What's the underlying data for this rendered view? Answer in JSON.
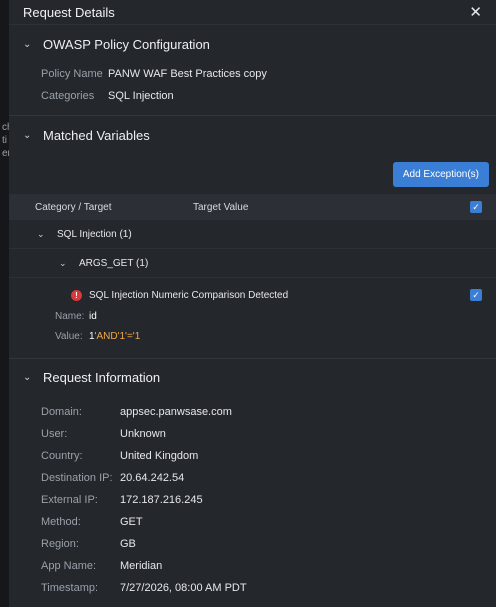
{
  "dialog": {
    "title": "Request Details"
  },
  "policy_section": {
    "title": "OWASP Policy Configuration",
    "policy_name_label": "Policy Name",
    "policy_name": "PANW WAF Best Practices copy",
    "categories_label": "Categories",
    "categories": "SQL Injection"
  },
  "matched_section": {
    "title": "Matched Variables",
    "add_exception_label": "Add Exception(s)",
    "columns": [
      "Category / Target",
      "Target Value"
    ],
    "group_label": "SQL Injection (1)",
    "subgroup_label": "ARGS_GET (1)",
    "detection": "SQL Injection Numeric Comparison Detected",
    "name_label": "Name:",
    "name_value": "id",
    "value_label": "Value:",
    "value_prefix": "1",
    "value_highlight": "'AND'1'='1"
  },
  "request_section": {
    "title": "Request Information",
    "fields": [
      {
        "label": "Domain:",
        "value": "appsec.panwsase.com"
      },
      {
        "label": "User:",
        "value": "Unknown"
      },
      {
        "label": "Country:",
        "value": "United Kingdom"
      },
      {
        "label": "Destination IP:",
        "value": "20.64.242.54"
      },
      {
        "label": "External IP:",
        "value": "172.187.216.245"
      },
      {
        "label": "Method:",
        "value": "GET"
      },
      {
        "label": "Region:",
        "value": "GB"
      },
      {
        "label": "App Name:",
        "value": "Meridian"
      },
      {
        "label": "Timestamp:",
        "value": "7/27/2026, 08:00 AM PDT"
      }
    ]
  },
  "icons": {
    "close": "close-icon",
    "chevron": "chevron-down-icon",
    "error": "error-icon",
    "check": "checkbox-checked-icon"
  },
  "colors": {
    "accent": "#3a7fd5",
    "error": "#d43b3b",
    "highlight": "#f0a94a",
    "background": "#24272c"
  }
}
